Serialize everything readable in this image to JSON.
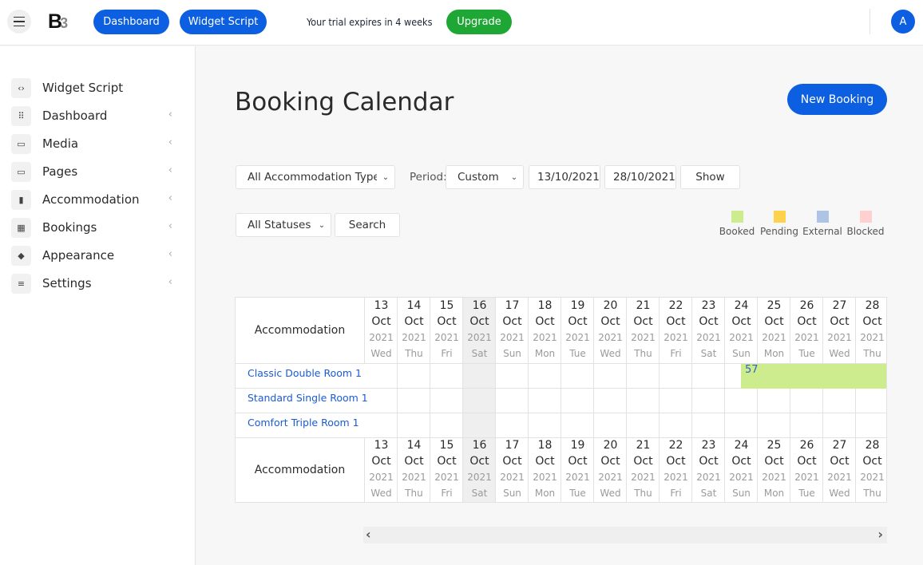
{
  "topbar": {
    "dashboard_label": "Dashboard",
    "widget_script_label": "Widget Script",
    "trial_text": "Your trial expires in 4 weeks",
    "upgrade_label": "Upgrade",
    "avatar_initial": "A"
  },
  "sidebar": {
    "items": [
      {
        "label": "Widget Script",
        "icon": "code-icon",
        "glyph": "‹›",
        "has_chevron": false
      },
      {
        "label": "Dashboard",
        "icon": "grid-icon",
        "glyph": "⠿",
        "has_chevron": true
      },
      {
        "label": "Media",
        "icon": "image-icon",
        "glyph": "▭",
        "has_chevron": true
      },
      {
        "label": "Pages",
        "icon": "pages-icon",
        "glyph": "▭",
        "has_chevron": true
      },
      {
        "label": "Accommodation",
        "icon": "building-icon",
        "glyph": "▮",
        "has_chevron": true
      },
      {
        "label": "Bookings",
        "icon": "calendar-icon",
        "glyph": "▦",
        "has_chevron": true
      },
      {
        "label": "Appearance",
        "icon": "paint-bucket-icon",
        "glyph": "◆",
        "has_chevron": true
      },
      {
        "label": "Settings",
        "icon": "sliders-icon",
        "glyph": "≡",
        "has_chevron": true
      }
    ],
    "chevron": "‹"
  },
  "main": {
    "title": "Booking Calendar",
    "new_booking_label": "New Booking",
    "filters": {
      "accommodation_type": "All Accommodation Types",
      "period_label": "Period:",
      "period_value": "Custom",
      "date_from": "13/10/2021",
      "date_to": "28/10/2021",
      "show_label": "Show",
      "status_value": "All Statuses",
      "search_label": "Search"
    },
    "legend": [
      {
        "label": "Booked",
        "color": "#cdec8d"
      },
      {
        "label": "Pending",
        "color": "#ffd24d"
      },
      {
        "label": "External",
        "color": "#aec4e4"
      },
      {
        "label": "Blocked",
        "color": "#ffd0d0"
      }
    ],
    "calendar": {
      "accommodation_header": "Accommodation",
      "days": [
        {
          "day": "13",
          "month": "Oct",
          "year": "2021",
          "weekday": "Wed",
          "shaded": false
        },
        {
          "day": "14",
          "month": "Oct",
          "year": "2021",
          "weekday": "Thu",
          "shaded": false
        },
        {
          "day": "15",
          "month": "Oct",
          "year": "2021",
          "weekday": "Fri",
          "shaded": false
        },
        {
          "day": "16",
          "month": "Oct",
          "year": "2021",
          "weekday": "Sat",
          "shaded": true
        },
        {
          "day": "17",
          "month": "Oct",
          "year": "2021",
          "weekday": "Sun",
          "shaded": false
        },
        {
          "day": "18",
          "month": "Oct",
          "year": "2021",
          "weekday": "Mon",
          "shaded": false
        },
        {
          "day": "19",
          "month": "Oct",
          "year": "2021",
          "weekday": "Tue",
          "shaded": false
        },
        {
          "day": "20",
          "month": "Oct",
          "year": "2021",
          "weekday": "Wed",
          "shaded": false
        },
        {
          "day": "21",
          "month": "Oct",
          "year": "2021",
          "weekday": "Thu",
          "shaded": false
        },
        {
          "day": "22",
          "month": "Oct",
          "year": "2021",
          "weekday": "Fri",
          "shaded": false
        },
        {
          "day": "23",
          "month": "Oct",
          "year": "2021",
          "weekday": "Sat",
          "shaded": false
        },
        {
          "day": "24",
          "month": "Oct",
          "year": "2021",
          "weekday": "Sun",
          "shaded": false
        },
        {
          "day": "25",
          "month": "Oct",
          "year": "2021",
          "weekday": "Mon",
          "shaded": false
        },
        {
          "day": "26",
          "month": "Oct",
          "year": "2021",
          "weekday": "Tue",
          "shaded": false
        },
        {
          "day": "27",
          "month": "Oct",
          "year": "2021",
          "weekday": "Wed",
          "shaded": false
        },
        {
          "day": "28",
          "month": "Oct",
          "year": "2021",
          "weekday": "Thu",
          "shaded": false
        }
      ],
      "rooms": [
        {
          "name": "Classic Double Room 1"
        },
        {
          "name": "Standard Single Room 1"
        },
        {
          "name": "Comfort Triple Room 1"
        }
      ],
      "bookings": [
        {
          "room_index": 0,
          "id": "57",
          "status": "Booked",
          "start_day_index": 11,
          "start": "24 Oct 2021 (afternoon)",
          "end": "28 Oct 2021+"
        }
      ]
    },
    "scroll": {
      "left": "‹",
      "right": "›"
    }
  }
}
